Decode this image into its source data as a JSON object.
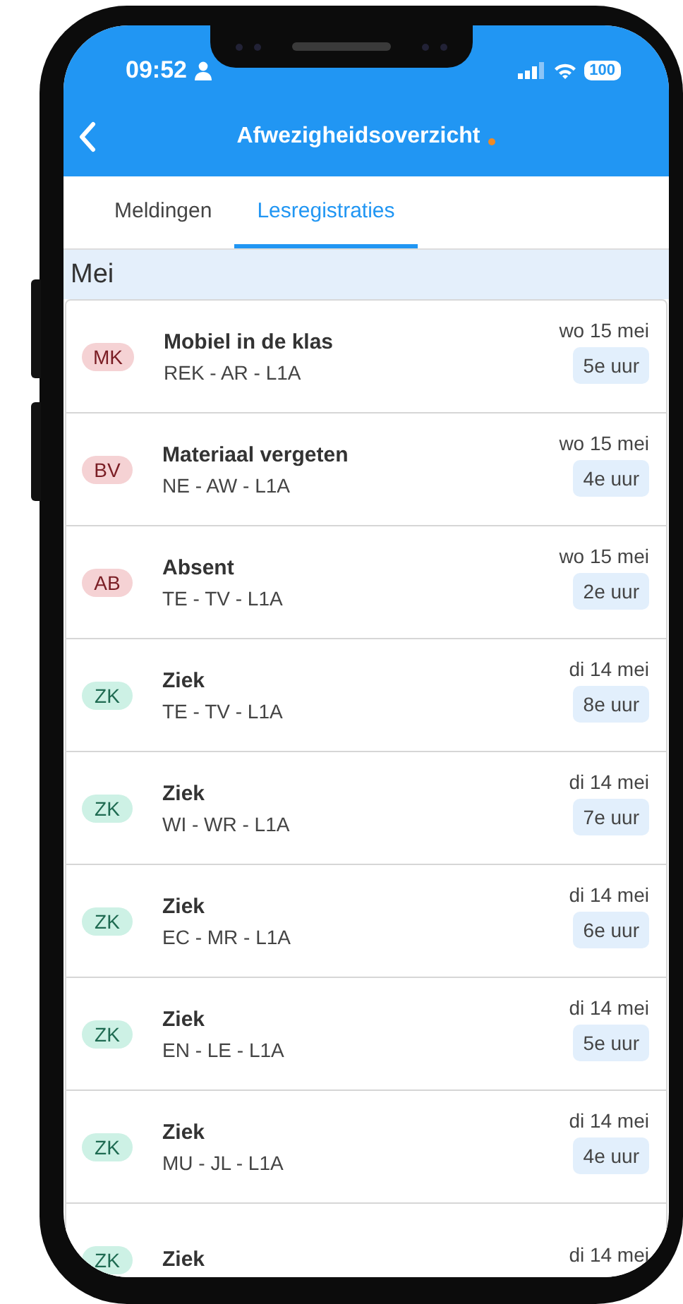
{
  "status_bar": {
    "time": "09:52",
    "battery": "100"
  },
  "header": {
    "title": "Afwezigheidsoverzicht",
    "unsaved_dot": true
  },
  "tabs": [
    {
      "label": "Meldingen",
      "selected": false
    },
    {
      "label": "Lesregistraties",
      "selected": true
    }
  ],
  "section": {
    "title": "Mei"
  },
  "rows": [
    {
      "code": "MK",
      "kind": "incident",
      "title": "Mobiel in de klas",
      "subtitle": "REK - AR - L1A",
      "date": "wo 15 mei",
      "period": "5e uur"
    },
    {
      "code": "BV",
      "kind": "incident",
      "title": "Materiaal vergeten",
      "subtitle": "NE - AW - L1A",
      "date": "wo 15 mei",
      "period": "4e uur"
    },
    {
      "code": "AB",
      "kind": "incident",
      "title": "Absent",
      "subtitle": "TE - TV - L1A",
      "date": "wo 15 mei",
      "period": "2e uur"
    },
    {
      "code": "ZK",
      "kind": "illness",
      "title": "Ziek",
      "subtitle": "TE - TV - L1A",
      "date": "di 14 mei",
      "period": "8e uur"
    },
    {
      "code": "ZK",
      "kind": "illness",
      "title": "Ziek",
      "subtitle": "WI - WR - L1A",
      "date": "di 14 mei",
      "period": "7e uur"
    },
    {
      "code": "ZK",
      "kind": "illness",
      "title": "Ziek",
      "subtitle": "EC - MR - L1A",
      "date": "di 14 mei",
      "period": "6e uur"
    },
    {
      "code": "ZK",
      "kind": "illness",
      "title": "Ziek",
      "subtitle": "EN - LE - L1A",
      "date": "di 14 mei",
      "period": "5e uur"
    },
    {
      "code": "ZK",
      "kind": "illness",
      "title": "Ziek",
      "subtitle": "MU - JL - L1A",
      "date": "di 14 mei",
      "period": "4e uur"
    },
    {
      "code": "ZK",
      "kind": "illness",
      "title": "Ziek",
      "date": "di 14 mei"
    }
  ]
}
